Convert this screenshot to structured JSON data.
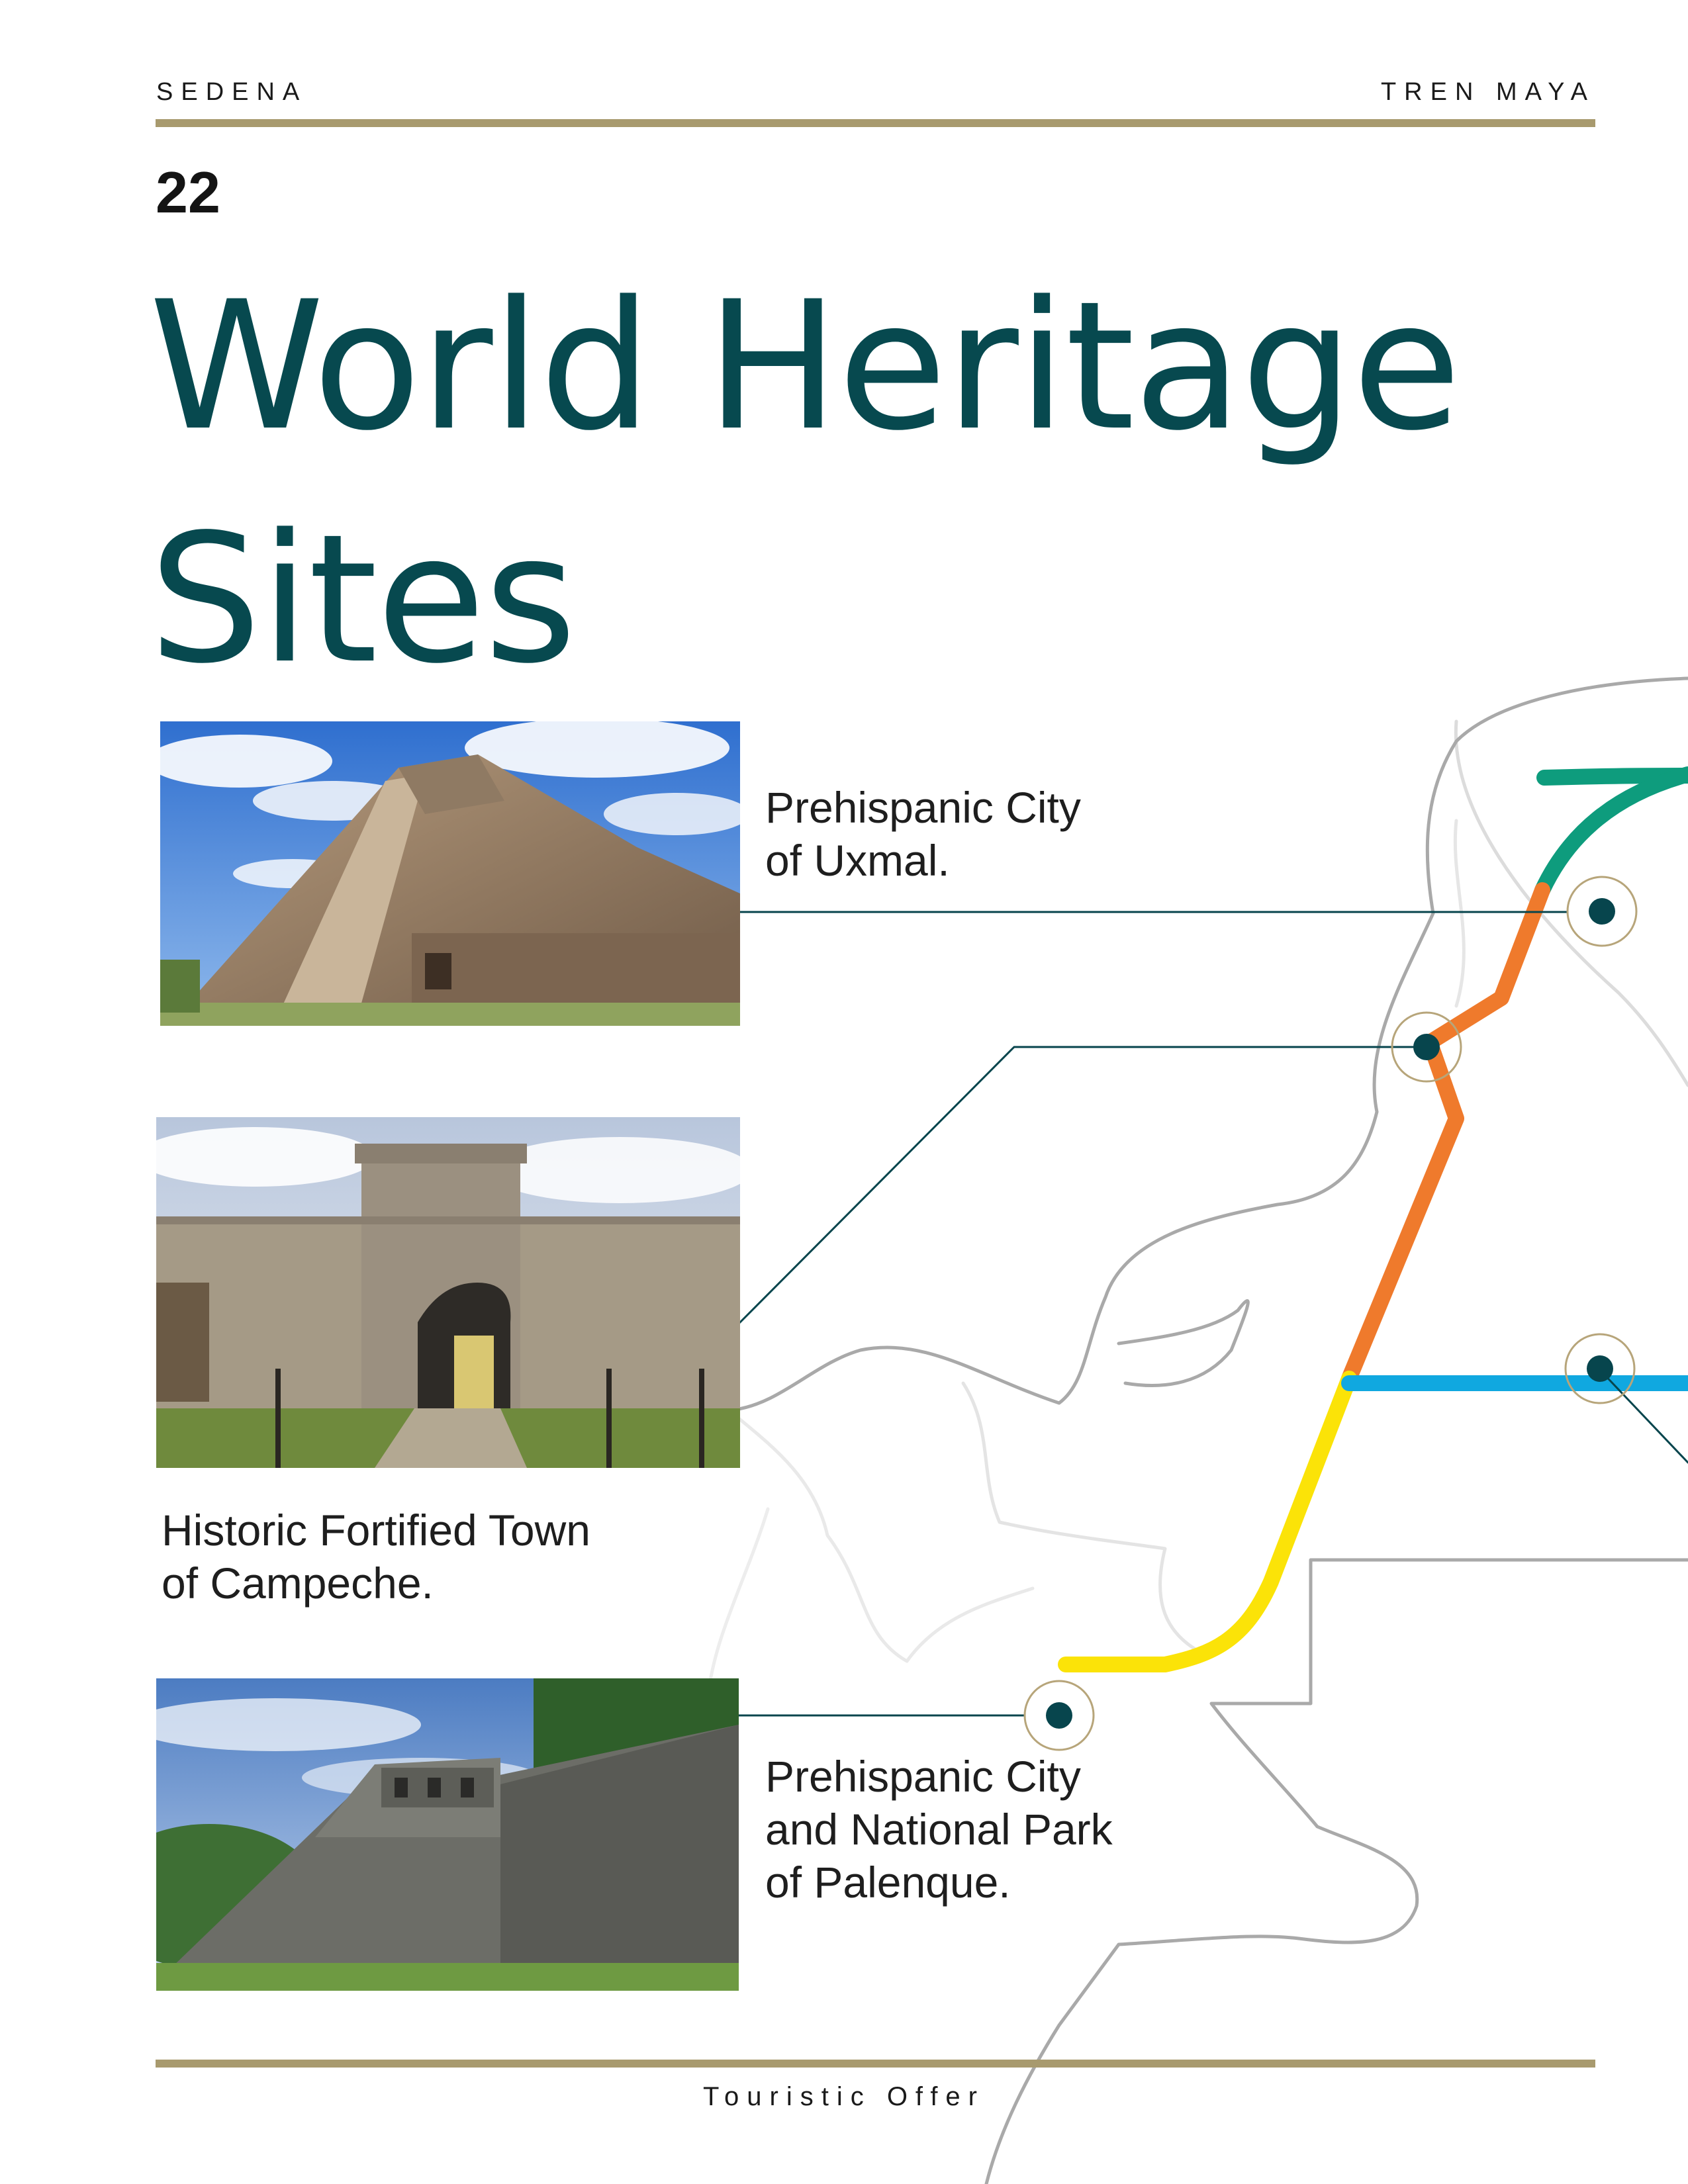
{
  "header": {
    "left": "SEDENA",
    "right": "TREN MAYA",
    "rule_color": "#a89a6e"
  },
  "page_number": "22",
  "title": {
    "line1": "World Heritage",
    "line2": "Sites",
    "color": "#07494f"
  },
  "sites": [
    {
      "line1": "Prehispanic City",
      "line2": "of Uxmal.",
      "line3": "",
      "photo": "pyramid-of-the-magician-photo"
    },
    {
      "line1": "Historic Fortified Town",
      "line2": "of Campeche.",
      "line3": "",
      "photo": "fortified-gate-photo"
    },
    {
      "line1": "Prehispanic City",
      "line2": "and National Park",
      "line3": "of Palenque.",
      "photo": "palenque-temple-photo"
    }
  ],
  "map": {
    "route_colors": {
      "green": "#0e9c7d",
      "orange": "#ef7a2c",
      "yellow": "#fbe308",
      "blue": "#10a8e0"
    },
    "marker_color": "#07454d",
    "ring_color": "#b7a57a"
  },
  "footer": "Touristic Offer"
}
